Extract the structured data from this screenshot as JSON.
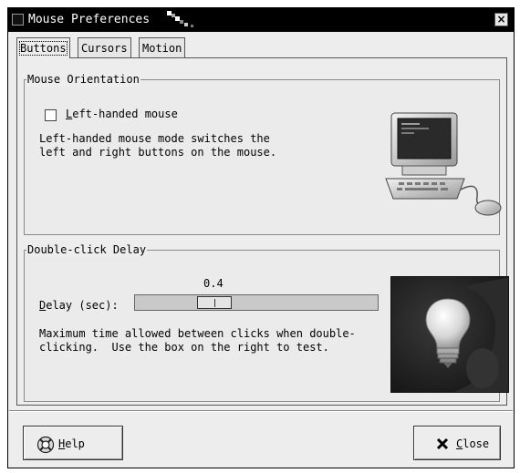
{
  "window": {
    "title": "Mouse Preferences",
    "close_glyph": "×"
  },
  "tabs": [
    {
      "label": "Buttons",
      "active": true
    },
    {
      "label": "Cursors",
      "active": false
    },
    {
      "label": "Motion",
      "active": false
    }
  ],
  "orientation": {
    "frame_label": "Mouse Orientation",
    "checkbox_mnemonic": "L",
    "checkbox_rest": "eft-handed mouse",
    "checkbox_checked": false,
    "description": "Left-handed mouse mode switches the\nleft and right buttons on the mouse.",
    "image_icon": "computer-mouse-icon"
  },
  "double_click": {
    "frame_label": "Double-click Delay",
    "slider_value": "0.4",
    "slider_fraction": 0.3,
    "delay_mnemonic": "D",
    "delay_rest": "elay (sec):",
    "description": "Maximum time allowed between clicks when double-\nclicking.  Use the box on the right to test.",
    "test_icon": "lightbulb-icon"
  },
  "buttons": {
    "help_mnemonic": "H",
    "help_rest": "elp",
    "help_icon": "lifebuoy-icon",
    "close_mnemonic": "C",
    "close_rest": "lose",
    "close_icon": "close-x-icon"
  }
}
